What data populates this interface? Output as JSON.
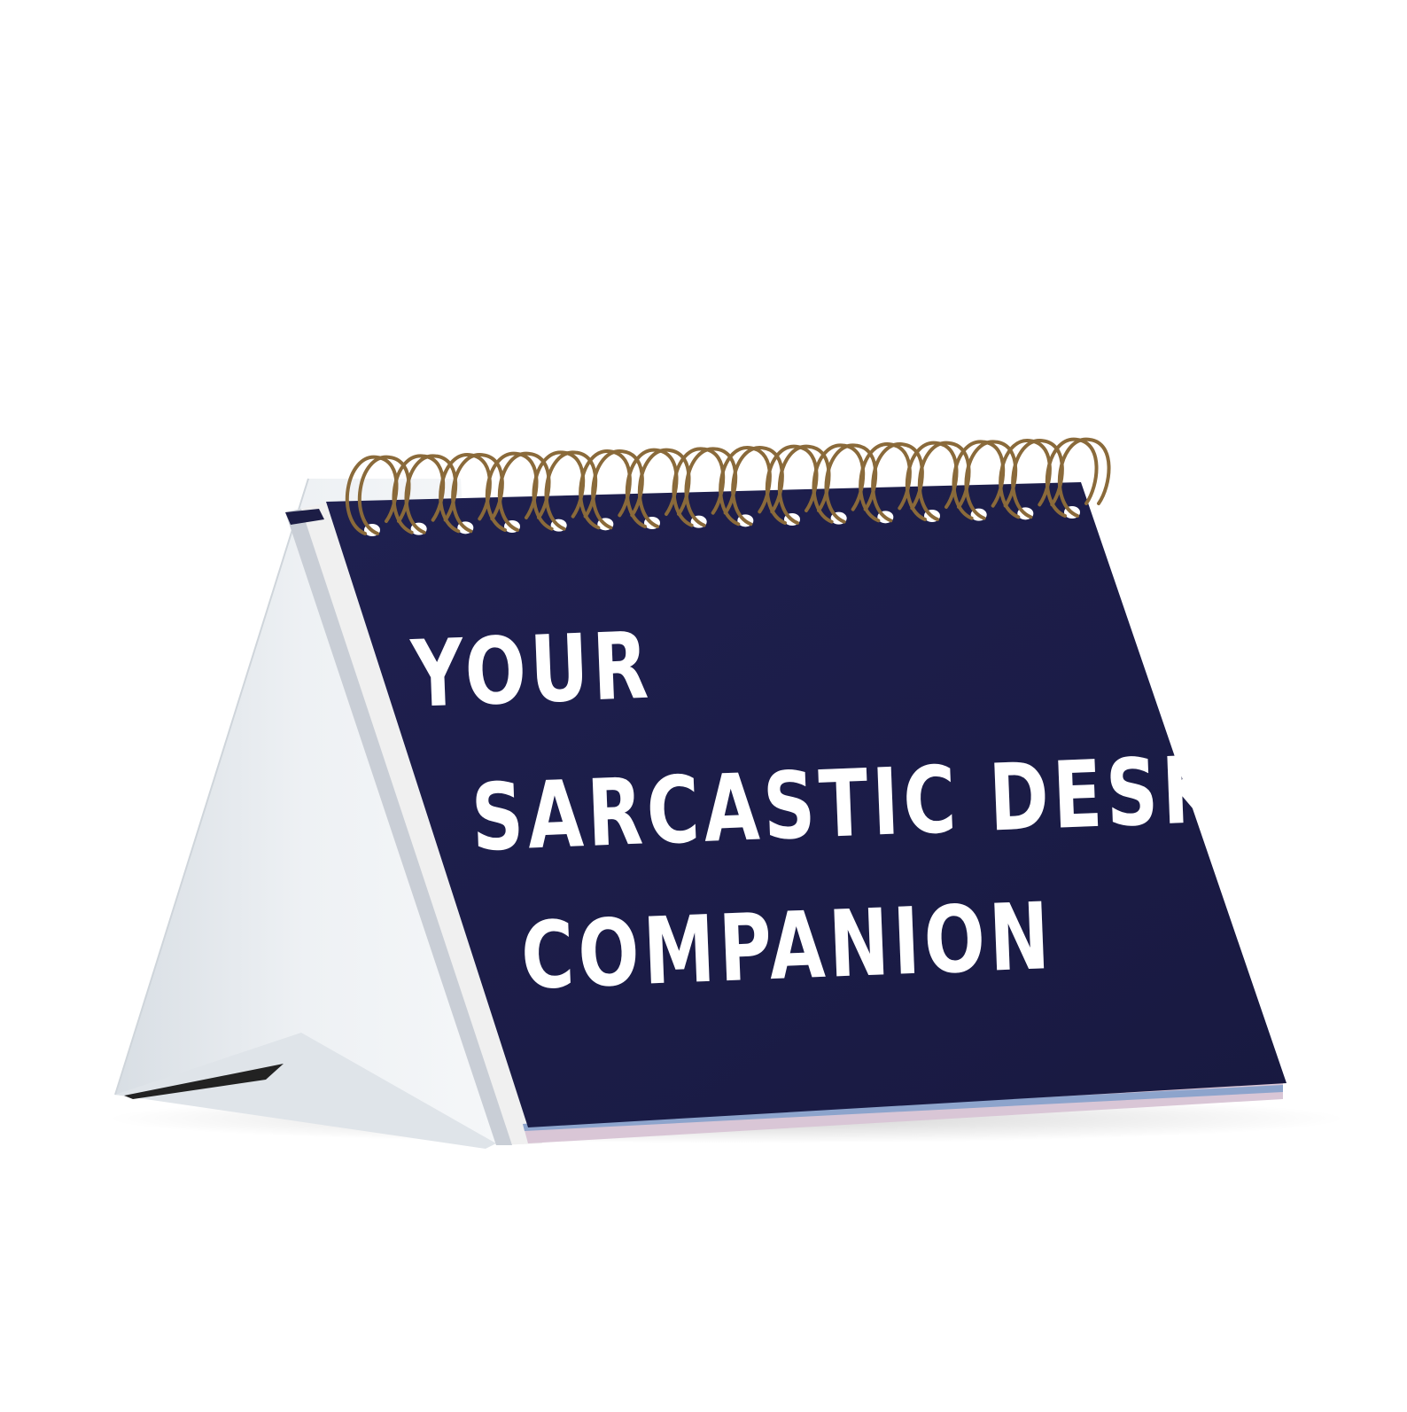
{
  "product": {
    "cover_line_1": "YOUR",
    "cover_line_2": "SARCASTIC DESK",
    "cover_line_3": "COMPANION"
  },
  "colors": {
    "background": "#ffffff",
    "cover": "#1c1d45",
    "stand": "#e6ebf0",
    "spiral": "#8a6a3a",
    "text": "#ffffff"
  },
  "spiral_ring_count": 16
}
